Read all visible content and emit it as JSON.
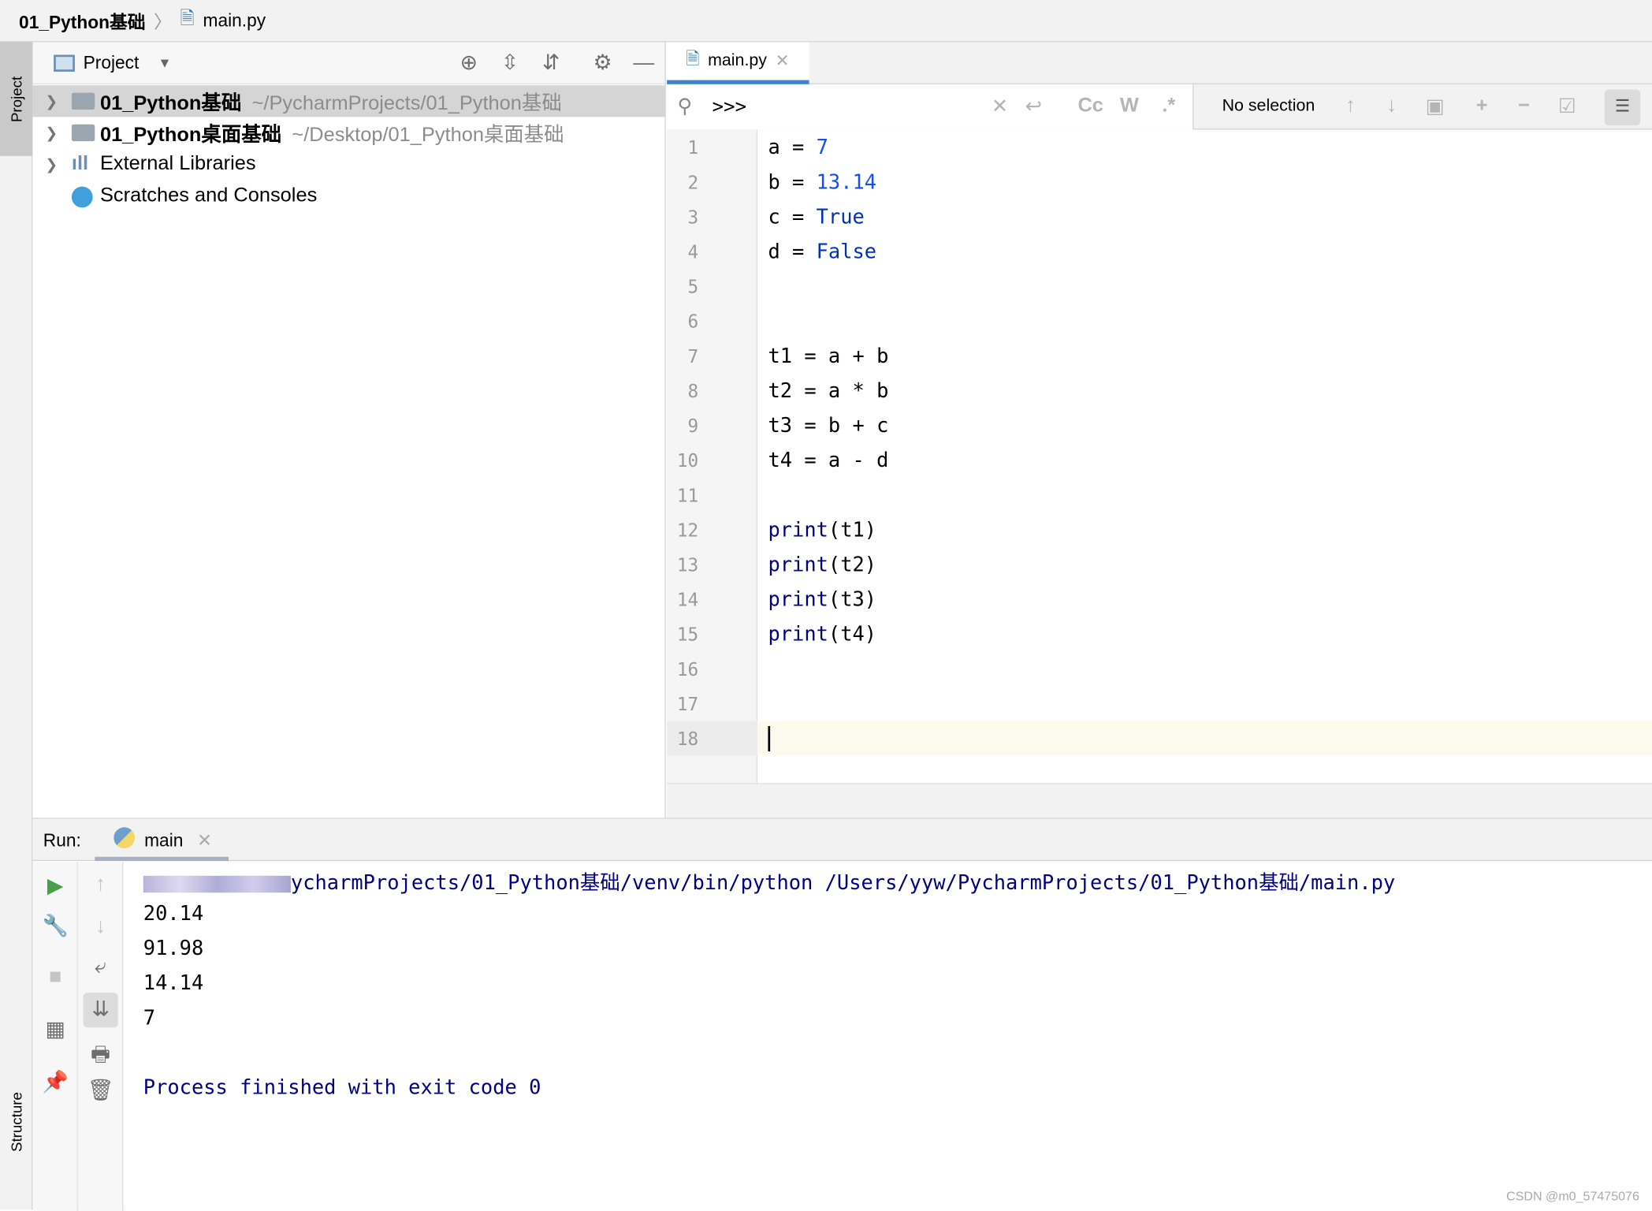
{
  "breadcrumb": {
    "project": "01_Python基础",
    "file": "main.py"
  },
  "left_strip": {
    "project_tab": "Project",
    "structure_tab": "Structure"
  },
  "project_panel": {
    "title": "Project",
    "tree": [
      {
        "label": "01_Python基础",
        "path": "~/PycharmProjects/01_Python基础",
        "icon": "folder-icon",
        "selected": true
      },
      {
        "label": "01_Python桌面基础",
        "path": "~/Desktop/01_Python桌面基础",
        "icon": "folder-icon"
      },
      {
        "label": "External Libraries",
        "icon": "libraries-icon"
      },
      {
        "label": "Scratches and Consoles",
        "icon": "scratches-icon"
      }
    ]
  },
  "editor": {
    "tab": "main.py",
    "search": {
      "value": ">>>",
      "selection": "No selection",
      "case_btn": "Cc",
      "word_btn": "W",
      "regex_btn": ".*"
    },
    "lines": [
      [
        [
          "a = ",
          ""
        ],
        [
          "7",
          "num"
        ]
      ],
      [
        [
          "b = ",
          ""
        ],
        [
          "13.14",
          "num"
        ]
      ],
      [
        [
          "c = ",
          ""
        ],
        [
          "True",
          "kw"
        ]
      ],
      [
        [
          "d = ",
          ""
        ],
        [
          "False",
          "kw"
        ]
      ],
      [],
      [],
      [
        [
          "t1 = a + b",
          ""
        ]
      ],
      [
        [
          "t2 = a * b",
          ""
        ]
      ],
      [
        [
          "t3 = b + c",
          ""
        ]
      ],
      [
        [
          "t4 = a - d",
          ""
        ]
      ],
      [],
      [
        [
          "print",
          "fn"
        ],
        [
          "(t1)",
          ""
        ]
      ],
      [
        [
          "print",
          "fn"
        ],
        [
          "(t2)",
          ""
        ]
      ],
      [
        [
          "print",
          "fn"
        ],
        [
          "(t3)",
          ""
        ]
      ],
      [
        [
          "print",
          "fn"
        ],
        [
          "(t4)",
          ""
        ]
      ],
      [],
      [],
      []
    ],
    "current_line": 18
  },
  "run": {
    "label": "Run:",
    "tab": "main",
    "command": "ycharmProjects/01_Python基础/venv/bin/python /Users/yyw/PycharmProjects/01_Python基础/main.py",
    "output": [
      "20.14",
      "91.98",
      "14.14",
      "7"
    ],
    "exit": "Process finished with exit code 0"
  },
  "watermark": "CSDN @m0_57475076",
  "colors": {
    "accent": "#4083c9",
    "number": "#1750eb",
    "keyword": "#0033b3",
    "builtin": "#000080"
  }
}
